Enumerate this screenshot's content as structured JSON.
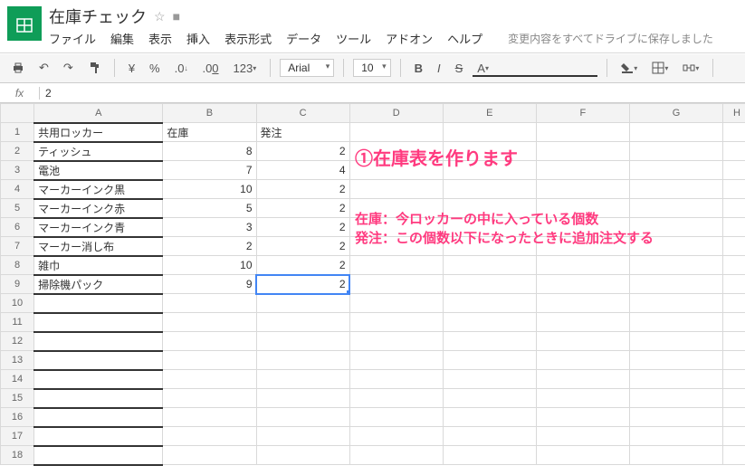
{
  "header": {
    "doc_title": "在庫チェック"
  },
  "menu": {
    "file": "ファイル",
    "edit": "編集",
    "view": "表示",
    "insert": "挿入",
    "format": "表示形式",
    "data": "データ",
    "tools": "ツール",
    "addons": "アドオン",
    "help": "ヘルプ",
    "save_status": "変更内容をすべてドライブに保存しました"
  },
  "toolbar": {
    "currency": "¥",
    "percent": "%",
    "dec_dec": ".0",
    "dec_inc": ".00",
    "numfmt": "123",
    "font": "Arial",
    "size": "10",
    "bold": "B",
    "italic": "I",
    "strike": "S",
    "textcolor": "A"
  },
  "fx": {
    "label": "fx",
    "value": "2"
  },
  "columns": [
    "A",
    "B",
    "C",
    "D",
    "E",
    "F",
    "G",
    "H"
  ],
  "rows": [
    {
      "n": 1,
      "a": "共用ロッカー",
      "b": "在庫",
      "c": "発注"
    },
    {
      "n": 2,
      "a": "ティッシュ",
      "b": "8",
      "c": "2"
    },
    {
      "n": 3,
      "a": "電池",
      "b": "7",
      "c": "4"
    },
    {
      "n": 4,
      "a": "マーカーインク黒",
      "b": "10",
      "c": "2"
    },
    {
      "n": 5,
      "a": "マーカーインク赤",
      "b": "5",
      "c": "2"
    },
    {
      "n": 6,
      "a": "マーカーインク青",
      "b": "3",
      "c": "2"
    },
    {
      "n": 7,
      "a": "マーカー消し布",
      "b": "2",
      "c": "2"
    },
    {
      "n": 8,
      "a": "雑巾",
      "b": "10",
      "c": "2"
    },
    {
      "n": 9,
      "a": "掃除機パック",
      "b": "9",
      "c": "2"
    },
    {
      "n": 10
    },
    {
      "n": 11
    },
    {
      "n": 12
    },
    {
      "n": 13
    },
    {
      "n": 14
    },
    {
      "n": 15
    },
    {
      "n": 16
    },
    {
      "n": 17
    },
    {
      "n": 18
    }
  ],
  "active": {
    "row": 9,
    "col": "C"
  },
  "overlay": {
    "title": "①在庫表を作ります",
    "line1": "在庫：今ロッカーの中に入っている個数",
    "line2": "発注：この個数以下になったときに追加注文する"
  },
  "chart_data": {
    "type": "table",
    "title": "在庫チェック",
    "columns": [
      "共用ロッカー",
      "在庫",
      "発注"
    ],
    "rows": [
      [
        "ティッシュ",
        8,
        2
      ],
      [
        "電池",
        7,
        4
      ],
      [
        "マーカーインク黒",
        10,
        2
      ],
      [
        "マーカーインク赤",
        5,
        2
      ],
      [
        "マーカーインク青",
        3,
        2
      ],
      [
        "マーカー消し布",
        2,
        2
      ],
      [
        "雑巾",
        10,
        2
      ],
      [
        "掃除機パック",
        9,
        2
      ]
    ]
  }
}
